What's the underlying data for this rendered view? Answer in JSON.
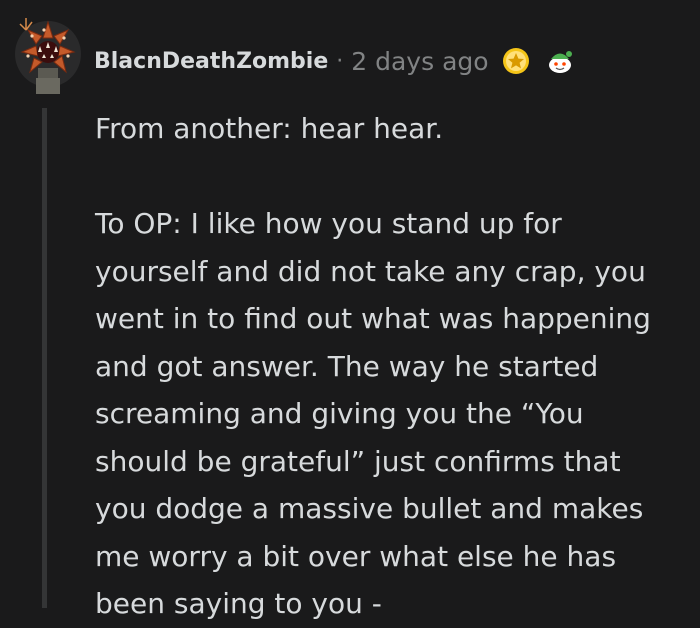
{
  "comment": {
    "username": "BlacnDeathZombie",
    "separator": "·",
    "timestamp": "2 days ago",
    "awards": [
      "gold-star-award-icon",
      "snoo-award-icon"
    ],
    "paragraphs": [
      "From another: hear hear.",
      "To OP: I like how you stand up for yourself and did not take any crap, you went in to find out what was happening and got answer. The way he started screaming and giving you the “You should be grateful” just confirms that you dodge a massive bullet and makes me worry a bit over what else he has been saying to you -"
    ]
  },
  "colors": {
    "background": "#1a1a1b",
    "text": "#d7dadc",
    "muted": "#818384",
    "thread_line": "#343536",
    "gold": "#f5c518"
  }
}
